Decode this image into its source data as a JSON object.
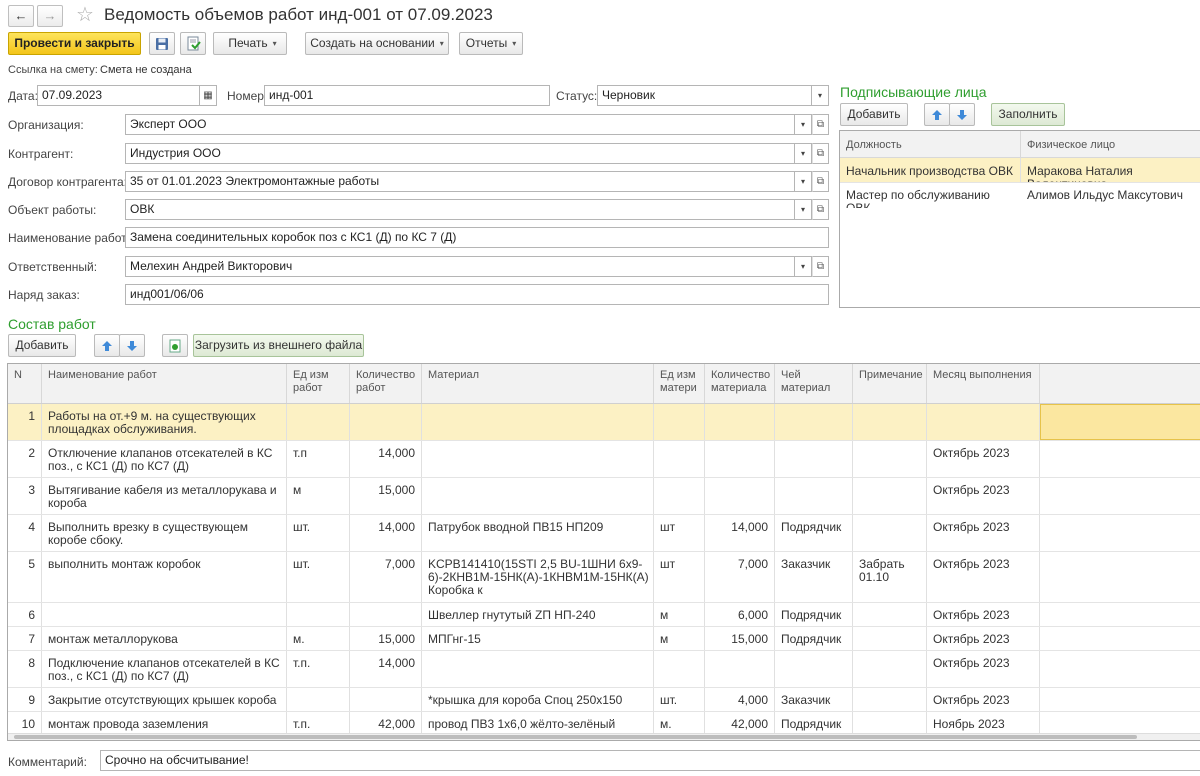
{
  "header": {
    "title": "Ведомость объемов работ инд-001 от 07.09.2023",
    "back": "←",
    "forward": "→",
    "star": "☆"
  },
  "toolbar": {
    "post_close": "Провести и закрыть",
    "print": "Печать",
    "create_based": "Создать на основании",
    "reports": "Отчеты",
    "dropdown_arrow": "▾"
  },
  "estimate_link": {
    "label": "Ссылка на смету:",
    "value": "Смета не создана"
  },
  "fields": {
    "date_label": "Дата:",
    "date_value": "07.09.2023",
    "number_label": "Номер:",
    "number_value": "инд-001",
    "status_label": "Статус:",
    "status_value": "Черновик",
    "org_label": "Организация:",
    "org_value": "Эксперт ООО",
    "counterparty_label": "Контрагент:",
    "counterparty_value": "Индустрия ООО",
    "contract_label": "Договор контрагента:",
    "contract_value": "35 от 01.01.2023 Электромонтажные работы",
    "object_label": "Объект работы:",
    "object_value": "ОВК",
    "workname_label": "Наименование работы:",
    "workname_value": "Замена соединительных коробок поз с КС1 (Д) по КС 7 (Д)",
    "responsible_label": "Ответственный:",
    "responsible_value": "Мелехин Андрей Викторович",
    "order_label": "Наряд заказ:",
    "order_value": "инд001/06/06"
  },
  "signers": {
    "title": "Подписывающие лица",
    "add": "Добавить",
    "fill": "Заполнить",
    "columns": [
      "Должность",
      "Физическое лицо"
    ],
    "rows": [
      [
        "Начальник производства ОВК",
        "Маракова Наталия Валентиновна"
      ],
      [
        "Мастер по обслуживанию ОВК",
        "Алимов Ильдус Максутович"
      ]
    ]
  },
  "works": {
    "title": "Состав работ",
    "add": "Добавить",
    "load": "Загрузить из внешнего файла",
    "columns": {
      "n": "N",
      "name": "Наименование работ",
      "unit": "Ед изм работ",
      "qty": "Количество работ",
      "material": "Материал",
      "munit": "Ед изм матери",
      "mqty": "Количество материала",
      "owner": "Чей материал",
      "note": "Примечание",
      "month": "Месяц выполнения"
    },
    "rows": [
      {
        "n": "1",
        "name": "Работы на от.+9 м. на существующих площадках обслуживания.",
        "unit": "",
        "qty": "",
        "material": "",
        "munit": "",
        "mqty": "",
        "owner": "",
        "note": "",
        "month": ""
      },
      {
        "n": "2",
        "name": "Отключение клапанов отсекателей в КС поз., с  КС1 (Д) по КС7 (Д)",
        "unit": "т.п",
        "qty": "14,000",
        "material": "",
        "munit": "",
        "mqty": "",
        "owner": "",
        "note": "",
        "month": "Октябрь 2023"
      },
      {
        "n": "3",
        "name": "Вытягивание кабеля из металлорукава и короба",
        "unit": "м",
        "qty": "15,000",
        "material": "",
        "munit": "",
        "mqty": "",
        "owner": "",
        "note": "",
        "month": "Октябрь 2023"
      },
      {
        "n": "4",
        "name": "Выполнить врезку в существующем коробе сбоку.",
        "unit": "шт.",
        "qty": "14,000",
        "material": "Патрубок вводной ПВ15 НП209",
        "munit": "шт",
        "mqty": "14,000",
        "owner": "Подрядчик",
        "note": "",
        "month": "Октябрь 2023"
      },
      {
        "n": "5",
        "name": "выполнить монтаж коробок",
        "unit": "шт.",
        "qty": "7,000",
        "material": "KCPB141410(15STI 2,5 BU-1ШНИ 6x9-6)-2КНВ1М-15НК(А)-1КНВМ1М-15НК(А) Коробка к",
        "munit": "шт",
        "mqty": "7,000",
        "owner": "Заказчик",
        "note": "Забрать 01.10",
        "month": "Октябрь 2023"
      },
      {
        "n": "6",
        "name": "",
        "unit": "",
        "qty": "",
        "material": "Швеллер гнутутый  ZП НП-240",
        "munit": "м",
        "mqty": "6,000",
        "owner": "Подрядчик",
        "note": "",
        "month": "Октябрь 2023"
      },
      {
        "n": "7",
        "name": "монтаж металлорукова",
        "unit": "м.",
        "qty": "15,000",
        "material": "МПГнг-15",
        "munit": "м",
        "mqty": "15,000",
        "owner": "Подрядчик",
        "note": "",
        "month": "Октябрь 2023"
      },
      {
        "n": "8",
        "name": "Подключение клапанов отсекателей в КС поз., с  КС1 (Д) по КС7 (Д)",
        "unit": "т.п.",
        "qty": "14,000",
        "material": "",
        "munit": "",
        "mqty": "",
        "owner": "",
        "note": "",
        "month": "Октябрь 2023"
      },
      {
        "n": "9",
        "name": "Закрытие отсутствующих крышек короба",
        "unit": "",
        "qty": "",
        "material": "*крышка для короба Споц 250x150",
        "munit": "шт.",
        "mqty": "4,000",
        "owner": "Заказчик",
        "note": "",
        "month": "Октябрь 2023"
      },
      {
        "n": "10",
        "name": "монтаж провода заземления",
        "unit": "т.п.",
        "qty": "42,000",
        "material": "провод ПВ3 1x6,0 жёлто-зелёный",
        "munit": "м.",
        "mqty": "42,000",
        "owner": "Подрядчик",
        "note": "",
        "month": "Ноябрь 2023"
      }
    ]
  },
  "comment": {
    "label": "Комментарий:",
    "value": "Срочно на обсчитывание!"
  }
}
